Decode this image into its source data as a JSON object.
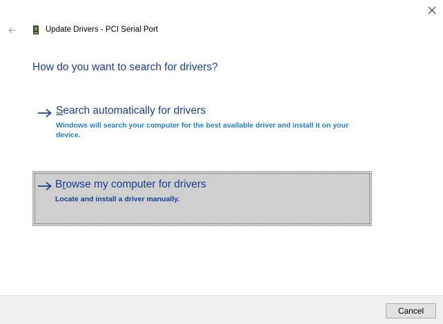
{
  "window": {
    "title": "Update Drivers - PCI Serial Port",
    "close_icon": "close-icon",
    "back_icon": "back-arrow-icon",
    "device_icon": "device-icon"
  },
  "main": {
    "heading": "How do you want to search for drivers?",
    "options": [
      {
        "title_accel": "S",
        "title_rest": "earch automatically for drivers",
        "description": "Windows will search your computer for the best available driver and install it on your device.",
        "icon": "arrow-right-icon"
      },
      {
        "title_prefix": "B",
        "title_accel": "r",
        "title_rest": "owse my computer for drivers",
        "description": "Locate and install a driver manually.",
        "icon": "arrow-right-icon",
        "selected": true
      }
    ]
  },
  "footer": {
    "cancel_label": "Cancel"
  },
  "colors": {
    "heading": "#1a3d8f",
    "link_description": "#1f7fc1",
    "selected_background": "#cfcfcf",
    "footer_background": "#f0f0f0"
  }
}
